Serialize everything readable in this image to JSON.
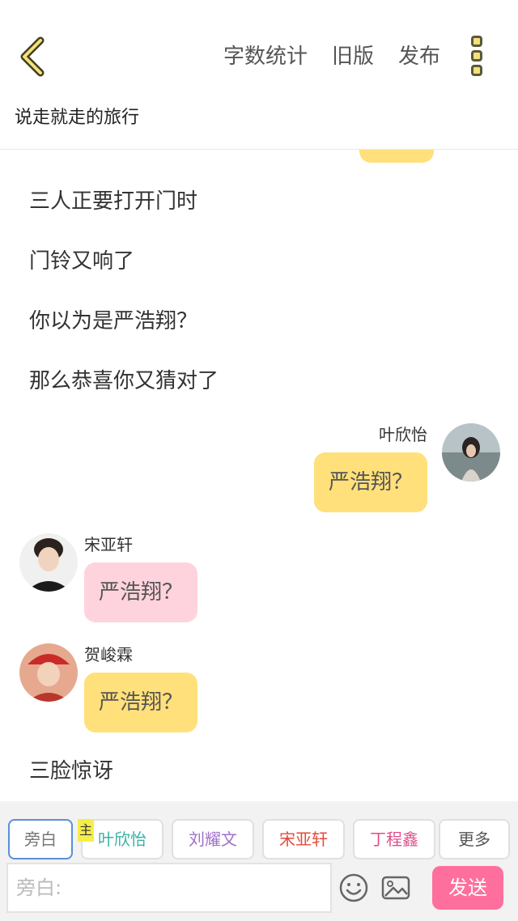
{
  "topbar": {
    "word_count": "字数统计",
    "old_version": "旧版",
    "publish": "发布"
  },
  "story_title": "说走就走的旅行",
  "chat": {
    "narrations": [
      "三人正要打开门时",
      "门铃又响了",
      "你以为是严浩翔？",
      "那么恭喜你又猜对了",
      "三脸惊讶"
    ],
    "messages": [
      {
        "sender": "叶欣怡",
        "text": "严浩翔？",
        "side": "right",
        "bubble_color": "#ffe07a"
      },
      {
        "sender": "宋亚轩",
        "text": "严浩翔？",
        "side": "left",
        "bubble_color": "#ffd3dd"
      },
      {
        "sender": "贺峻霖",
        "text": "严浩翔？",
        "side": "left",
        "bubble_color": "#ffe07a"
      }
    ]
  },
  "roles": {
    "narrator": {
      "label": "旁白",
      "color": "#777777"
    },
    "host_badge": "主",
    "items": [
      {
        "label": "叶欣怡",
        "color": "#38b2a3"
      },
      {
        "label": "刘耀文",
        "color": "#a072c8"
      },
      {
        "label": "宋亚轩",
        "color": "#e2493b"
      },
      {
        "label": "丁程鑫",
        "color": "#e04f8a"
      }
    ],
    "more": {
      "label": "更多",
      "color": "#555555"
    }
  },
  "input": {
    "placeholder": "旁白:"
  },
  "send_label": "发送",
  "icons": [
    "back-arrow-icon",
    "more-vertical-icon",
    "emoji-icon",
    "image-icon"
  ]
}
